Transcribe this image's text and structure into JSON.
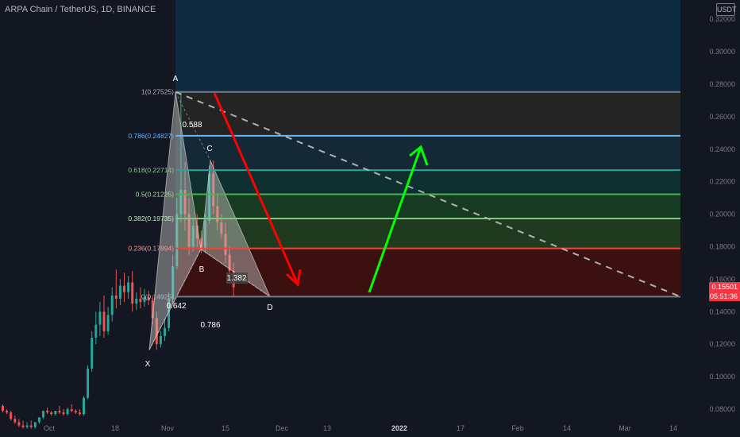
{
  "header": {
    "symbol_title": "ARPA Chain / TetherUS, 1D, BINANCE",
    "currency_badge": "USDT"
  },
  "price_badge": {
    "price": "0.15501",
    "countdown": "05:51:36",
    "color": "#f23645"
  },
  "colors": {
    "background": "#131722",
    "up": "#26a69a",
    "down": "#ef5350",
    "arrow_down": "#ff0000",
    "arrow_up": "#00ff00"
  },
  "chart_data": {
    "type": "candlestick",
    "y_ticks": [
      "0.08000",
      "0.10000",
      "0.12000",
      "0.14000",
      "0.16000",
      "0.18000",
      "0.20000",
      "0.22000",
      "0.24000",
      "0.26000",
      "0.28000",
      "0.30000",
      "0.32000"
    ],
    "x_ticks": [
      "Oct",
      "18",
      "Nov",
      "15",
      "Dec",
      "13",
      "2022",
      "17",
      "Feb",
      "14",
      "Mar",
      "14"
    ],
    "ylim": [
      0.08,
      0.32
    ],
    "fib_levels": [
      {
        "label": "1(0.27525)",
        "value": 0.27525,
        "color": "#787b86",
        "text_color": "#b2b5be"
      },
      {
        "label": "0.786(0.24827)",
        "value": 0.24827,
        "color": "#64b5f6",
        "text_color": "#64b5f6"
      },
      {
        "label": "0.618(0.22714)",
        "value": 0.22714,
        "color": "#26a69a",
        "text_color": "#81c784"
      },
      {
        "label": "0.5(0.21225)",
        "value": 0.21225,
        "color": "#4caf50",
        "text_color": "#a5d6a7"
      },
      {
        "label": "0.382(0.19735)",
        "value": 0.19735,
        "color": "#81c784",
        "text_color": "#c8e6c9"
      },
      {
        "label": "0.236(0.17894)",
        "value": 0.17894,
        "color": "#f44336",
        "text_color": "#ef9a9a"
      },
      {
        "label": "0(0.14925)",
        "value": 0.14925,
        "color": "#787b86",
        "text_color": "#b2b5be"
      }
    ],
    "pattern_points": [
      {
        "name": "X",
        "value": 0.1165
      },
      {
        "name": "A",
        "value": 0.27525
      },
      {
        "name": "B",
        "value": 0.1785
      },
      {
        "name": "C",
        "value": 0.233
      },
      {
        "name": "D",
        "value": 0.14925
      }
    ],
    "ratios": [
      "0.588",
      "0.642",
      "0.786",
      "1.382"
    ],
    "candles": [
      [
        0.082,
        0.083,
        0.079,
        0.078
      ],
      [
        0.079,
        0.08,
        0.078,
        0.077
      ],
      [
        0.078,
        0.079,
        0.074,
        0.073
      ],
      [
        0.074,
        0.076,
        0.072,
        0.071
      ],
      [
        0.072,
        0.074,
        0.07,
        0.069
      ],
      [
        0.07,
        0.073,
        0.069,
        0.068
      ],
      [
        0.069,
        0.072,
        0.07,
        0.068
      ],
      [
        0.07,
        0.073,
        0.069,
        0.068
      ],
      [
        0.069,
        0.071,
        0.072,
        0.068
      ],
      [
        0.072,
        0.074,
        0.075,
        0.071
      ],
      [
        0.075,
        0.078,
        0.079,
        0.074
      ],
      [
        0.079,
        0.081,
        0.078,
        0.077
      ],
      [
        0.078,
        0.079,
        0.077,
        0.076
      ],
      [
        0.077,
        0.078,
        0.079,
        0.076
      ],
      [
        0.079,
        0.082,
        0.078,
        0.077
      ],
      [
        0.078,
        0.08,
        0.077,
        0.076
      ],
      [
        0.077,
        0.081,
        0.08,
        0.076
      ],
      [
        0.08,
        0.083,
        0.079,
        0.078
      ],
      [
        0.079,
        0.08,
        0.078,
        0.077
      ],
      [
        0.078,
        0.08,
        0.077,
        0.076
      ],
      [
        0.077,
        0.088,
        0.087,
        0.076
      ],
      [
        0.087,
        0.107,
        0.105,
        0.086
      ],
      [
        0.105,
        0.128,
        0.124,
        0.103
      ],
      [
        0.124,
        0.14,
        0.132,
        0.12
      ],
      [
        0.132,
        0.146,
        0.14,
        0.125
      ],
      [
        0.14,
        0.15,
        0.128,
        0.124
      ],
      [
        0.128,
        0.143,
        0.138,
        0.126
      ],
      [
        0.138,
        0.155,
        0.15,
        0.134
      ],
      [
        0.15,
        0.166,
        0.148,
        0.142
      ],
      [
        0.148,
        0.16,
        0.156,
        0.144
      ],
      [
        0.156,
        0.164,
        0.152,
        0.146
      ],
      [
        0.152,
        0.162,
        0.158,
        0.148
      ],
      [
        0.158,
        0.165,
        0.145,
        0.14
      ],
      [
        0.145,
        0.152,
        0.148,
        0.141
      ],
      [
        0.148,
        0.155,
        0.146,
        0.142
      ],
      [
        0.146,
        0.154,
        0.149,
        0.143
      ],
      [
        0.149,
        0.153,
        0.147,
        0.144
      ],
      [
        0.147,
        0.15,
        0.136,
        0.132
      ],
      [
        0.136,
        0.14,
        0.12,
        0.1165
      ],
      [
        0.12,
        0.128,
        0.125,
        0.118
      ],
      [
        0.125,
        0.135,
        0.13,
        0.122
      ],
      [
        0.13,
        0.152,
        0.148,
        0.128
      ],
      [
        0.148,
        0.175,
        0.168,
        0.145
      ],
      [
        0.168,
        0.21,
        0.2,
        0.166
      ],
      [
        0.2,
        0.27525,
        0.215,
        0.195
      ],
      [
        0.215,
        0.232,
        0.2,
        0.19
      ],
      [
        0.2,
        0.21,
        0.18,
        0.175
      ],
      [
        0.18,
        0.198,
        0.193,
        0.177
      ],
      [
        0.193,
        0.2,
        0.185,
        0.18
      ],
      [
        0.185,
        0.19,
        0.1785,
        0.176
      ],
      [
        0.1785,
        0.2,
        0.196,
        0.177
      ],
      [
        0.196,
        0.23,
        0.225,
        0.194
      ],
      [
        0.225,
        0.233,
        0.205,
        0.2
      ],
      [
        0.205,
        0.213,
        0.195,
        0.19
      ],
      [
        0.195,
        0.2,
        0.188,
        0.185
      ],
      [
        0.188,
        0.195,
        0.175,
        0.17
      ],
      [
        0.175,
        0.18,
        0.165,
        0.162
      ],
      [
        0.165,
        0.17,
        0.155,
        0.149
      ]
    ]
  }
}
